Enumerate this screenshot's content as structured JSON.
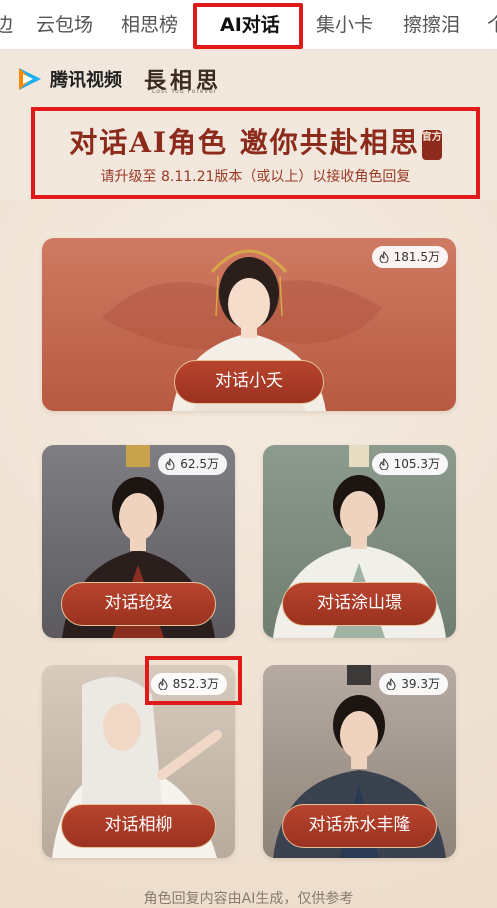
{
  "tabs": [
    {
      "label": "边",
      "active": false
    },
    {
      "label": "云包场",
      "active": false
    },
    {
      "label": "相思榜",
      "active": false
    },
    {
      "label": "AI对话",
      "active": true
    },
    {
      "label": "集小卡",
      "active": false
    },
    {
      "label": "擦擦泪",
      "active": false
    },
    {
      "label": "个",
      "active": false
    }
  ],
  "brand": {
    "name": "腾讯视频",
    "drama_logo": "長相思",
    "drama_sub": "Lost You Forever"
  },
  "headline": {
    "title": "对话AI角色 邀你共赴相思",
    "seal": "官方",
    "note": "请升级至 8.11.21版本（或以上）以接收角色回复"
  },
  "cards": [
    {
      "button": "对话小夭",
      "heat": "181.5万"
    },
    {
      "button": "对话玱玹",
      "heat": "62.5万"
    },
    {
      "button": "对话涂山璟",
      "heat": "105.3万"
    },
    {
      "button": "对话相柳",
      "heat": "852.3万"
    },
    {
      "button": "对话赤水丰隆",
      "heat": "39.3万"
    }
  ],
  "footer": "角色回复内容由AI生成，仅供参考",
  "colors": {
    "accent_red": "#e01a1a",
    "button_brown": "#a83a26",
    "headline_red": "#8c2a1c",
    "background": "#f1e7dc"
  },
  "icons": [
    "tencent-video-play-icon",
    "flame-icon"
  ]
}
